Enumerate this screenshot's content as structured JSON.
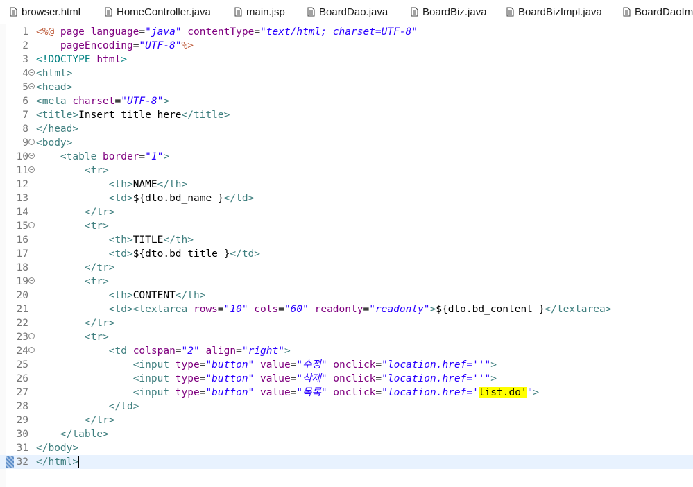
{
  "tabs": [
    {
      "label": "browser.html",
      "icon": "file-icon"
    },
    {
      "label": "HomeController.java",
      "icon": "file-icon"
    },
    {
      "label": "main.jsp",
      "icon": "file-icon"
    },
    {
      "label": "BoardDao.java",
      "icon": "file-icon"
    },
    {
      "label": "BoardBiz.java",
      "icon": "file-icon"
    },
    {
      "label": "BoardBizImpl.java",
      "icon": "file-icon"
    },
    {
      "label": "BoardDaoIm",
      "icon": "file-icon"
    }
  ],
  "editor": {
    "current_line": 32,
    "lines": [
      {
        "n": "1",
        "fold": false,
        "tokens": [
          [
            "k",
            "<%@ "
          ],
          [
            "a",
            "page "
          ],
          [
            "a",
            "language"
          ],
          [
            "",
            "="
          ],
          [
            "v",
            "\"java\""
          ],
          [
            "",
            ""
          ],
          [
            "a",
            " contentType"
          ],
          [
            "",
            "="
          ],
          [
            "v",
            "\"text/html; charset=UTF-8\""
          ]
        ]
      },
      {
        "n": "2",
        "fold": false,
        "tokens": [
          [
            "",
            "    "
          ],
          [
            "a",
            "pageEncoding"
          ],
          [
            "",
            "="
          ],
          [
            "v",
            "\"UTF-8\""
          ],
          [
            "k",
            "%>"
          ]
        ]
      },
      {
        "n": "3",
        "fold": false,
        "tokens": [
          [
            "d",
            "<!DOCTYPE "
          ],
          [
            "a",
            "html"
          ],
          [
            "d",
            ">"
          ]
        ]
      },
      {
        "n": "4",
        "fold": true,
        "tokens": [
          [
            "t",
            "<html>"
          ]
        ]
      },
      {
        "n": "5",
        "fold": true,
        "tokens": [
          [
            "t",
            "<head>"
          ]
        ]
      },
      {
        "n": "6",
        "fold": false,
        "tokens": [
          [
            "t",
            "<meta "
          ],
          [
            "a",
            "charset"
          ],
          [
            "",
            "="
          ],
          [
            "v",
            "\"UTF-8\""
          ],
          [
            "t",
            ">"
          ]
        ]
      },
      {
        "n": "7",
        "fold": false,
        "tokens": [
          [
            "t",
            "<title>"
          ],
          [
            "",
            "Insert title here"
          ],
          [
            "t",
            "</title>"
          ]
        ]
      },
      {
        "n": "8",
        "fold": false,
        "tokens": [
          [
            "t",
            "</head>"
          ]
        ]
      },
      {
        "n": "9",
        "fold": true,
        "tokens": [
          [
            "t",
            "<body>"
          ]
        ]
      },
      {
        "n": "10",
        "fold": true,
        "tokens": [
          [
            "",
            "    "
          ],
          [
            "t",
            "<table "
          ],
          [
            "a",
            "border"
          ],
          [
            "",
            "="
          ],
          [
            "v",
            "\"1\""
          ],
          [
            "t",
            ">"
          ]
        ]
      },
      {
        "n": "11",
        "fold": true,
        "tokens": [
          [
            "",
            "        "
          ],
          [
            "t",
            "<tr>"
          ]
        ]
      },
      {
        "n": "12",
        "fold": false,
        "tokens": [
          [
            "",
            "            "
          ],
          [
            "t",
            "<th>"
          ],
          [
            "",
            "NAME"
          ],
          [
            "t",
            "</th>"
          ]
        ]
      },
      {
        "n": "13",
        "fold": false,
        "tokens": [
          [
            "",
            "            "
          ],
          [
            "t",
            "<td>"
          ],
          [
            "",
            "${dto.bd_name }"
          ],
          [
            "t",
            "</td>"
          ]
        ]
      },
      {
        "n": "14",
        "fold": false,
        "tokens": [
          [
            "",
            "        "
          ],
          [
            "t",
            "</tr>"
          ]
        ]
      },
      {
        "n": "15",
        "fold": true,
        "tokens": [
          [
            "",
            "        "
          ],
          [
            "t",
            "<tr>"
          ]
        ]
      },
      {
        "n": "16",
        "fold": false,
        "tokens": [
          [
            "",
            "            "
          ],
          [
            "t",
            "<th>"
          ],
          [
            "",
            "TITLE"
          ],
          [
            "t",
            "</th>"
          ]
        ]
      },
      {
        "n": "17",
        "fold": false,
        "tokens": [
          [
            "",
            "            "
          ],
          [
            "t",
            "<td>"
          ],
          [
            "",
            "${dto.bd_title }"
          ],
          [
            "t",
            "</td>"
          ]
        ]
      },
      {
        "n": "18",
        "fold": false,
        "tokens": [
          [
            "",
            "        "
          ],
          [
            "t",
            "</tr>"
          ]
        ]
      },
      {
        "n": "19",
        "fold": true,
        "tokens": [
          [
            "",
            "        "
          ],
          [
            "t",
            "<tr>"
          ]
        ]
      },
      {
        "n": "20",
        "fold": false,
        "tokens": [
          [
            "",
            "            "
          ],
          [
            "t",
            "<th>"
          ],
          [
            "",
            "CONTENT"
          ],
          [
            "t",
            "</th>"
          ]
        ]
      },
      {
        "n": "21",
        "fold": false,
        "tokens": [
          [
            "",
            "            "
          ],
          [
            "t",
            "<td><textarea "
          ],
          [
            "a",
            "rows"
          ],
          [
            "",
            "="
          ],
          [
            "v",
            "\"10\""
          ],
          [
            "a",
            " cols"
          ],
          [
            "",
            "="
          ],
          [
            "v",
            "\"60\""
          ],
          [
            "a",
            " readonly"
          ],
          [
            "",
            "="
          ],
          [
            "v",
            "\"readonly\""
          ],
          [
            "t",
            ">"
          ],
          [
            "",
            "${dto.bd_content }"
          ],
          [
            "t",
            "</textarea>"
          ]
        ]
      },
      {
        "n": "22",
        "fold": false,
        "tokens": [
          [
            "",
            "        "
          ],
          [
            "t",
            "</tr>"
          ]
        ]
      },
      {
        "n": "23",
        "fold": true,
        "tokens": [
          [
            "",
            "        "
          ],
          [
            "t",
            "<tr>"
          ]
        ]
      },
      {
        "n": "24",
        "fold": true,
        "tokens": [
          [
            "",
            "            "
          ],
          [
            "t",
            "<td "
          ],
          [
            "a",
            "colspan"
          ],
          [
            "",
            "="
          ],
          [
            "v",
            "\"2\""
          ],
          [
            "a",
            " align"
          ],
          [
            "",
            "="
          ],
          [
            "v",
            "\"right\""
          ],
          [
            "t",
            ">"
          ]
        ]
      },
      {
        "n": "25",
        "fold": false,
        "tokens": [
          [
            "",
            "                "
          ],
          [
            "t",
            "<input "
          ],
          [
            "a",
            "type"
          ],
          [
            "",
            "="
          ],
          [
            "v",
            "\"button\""
          ],
          [
            "a",
            " value"
          ],
          [
            "",
            "="
          ],
          [
            "v",
            "\"수정\""
          ],
          [
            "a",
            " onclick"
          ],
          [
            "",
            "="
          ],
          [
            "v",
            "\"location.href=''\""
          ],
          [
            "t",
            ">"
          ]
        ]
      },
      {
        "n": "26",
        "fold": false,
        "tokens": [
          [
            "",
            "                "
          ],
          [
            "t",
            "<input "
          ],
          [
            "a",
            "type"
          ],
          [
            "",
            "="
          ],
          [
            "v",
            "\"button\""
          ],
          [
            "a",
            " value"
          ],
          [
            "",
            "="
          ],
          [
            "v",
            "\"삭제\""
          ],
          [
            "a",
            " onclick"
          ],
          [
            "",
            "="
          ],
          [
            "v",
            "\"location.href=''\""
          ],
          [
            "t",
            ">"
          ]
        ]
      },
      {
        "n": "27",
        "fold": false,
        "tokens": [
          [
            "",
            "                "
          ],
          [
            "t",
            "<input "
          ],
          [
            "a",
            "type"
          ],
          [
            "",
            "="
          ],
          [
            "v",
            "\"button\""
          ],
          [
            "a",
            " value"
          ],
          [
            "",
            "="
          ],
          [
            "v",
            "\"목록\""
          ],
          [
            "a",
            " onclick"
          ],
          [
            "",
            "="
          ],
          [
            "v",
            "\"location.href='"
          ],
          [
            "hl",
            "list.do'"
          ],
          [
            "v",
            "\""
          ],
          [
            "t",
            ">"
          ]
        ]
      },
      {
        "n": "28",
        "fold": false,
        "tokens": [
          [
            "",
            "            "
          ],
          [
            "t",
            "</td>"
          ]
        ]
      },
      {
        "n": "29",
        "fold": false,
        "tokens": [
          [
            "",
            "        "
          ],
          [
            "t",
            "</tr>"
          ]
        ]
      },
      {
        "n": "30",
        "fold": false,
        "tokens": [
          [
            "",
            "    "
          ],
          [
            "t",
            "</table>"
          ]
        ]
      },
      {
        "n": "31",
        "fold": false,
        "tokens": [
          [
            "t",
            "</body>"
          ]
        ]
      },
      {
        "n": "32",
        "fold": false,
        "tokens": [
          [
            "t",
            "</html>"
          ]
        ]
      }
    ]
  },
  "colors": {
    "tag": "#3f7f7f",
    "attribute": "#7f007f",
    "string": "#2a00ff",
    "highlight": "#ffff00",
    "current_line": "#e8f2fe"
  }
}
